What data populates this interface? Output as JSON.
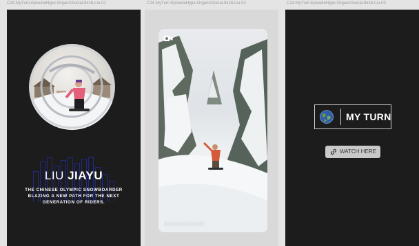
{
  "frames": [
    {
      "label": "C24-MyTurn-EpisodeHype-OrganicSocial-9x16-Liu-01"
    },
    {
      "label": "C24-MyTurn-EpisodeHype-OrganicSocial-9x16-Liu-02"
    },
    {
      "label": "C24-MyTurn-EpisodeHype-OrganicSocial-9x16-Liu-03"
    }
  ],
  "frame1": {
    "name_first": "LIU",
    "name_last": "JIAYU",
    "tagline": "THE CHINESE OLYMPIC SNOWBOARDER BLAZING A NEW PATH FOR THE NEXT GENERATION OF RIDERS."
  },
  "frame2": {
    "handle": "burtonsnowboards",
    "icon": "video-camera-icon"
  },
  "frame3": {
    "title": "MY TURN",
    "watch_label": "WATCH HERE",
    "icons": [
      "globe-icon",
      "link-icon"
    ]
  },
  "colors": {
    "dark_bg": "#1c1c1c",
    "canvas": "#e4e4e4",
    "bar_accent": "#1f2a86",
    "button_bg": "#c9c9c9"
  }
}
